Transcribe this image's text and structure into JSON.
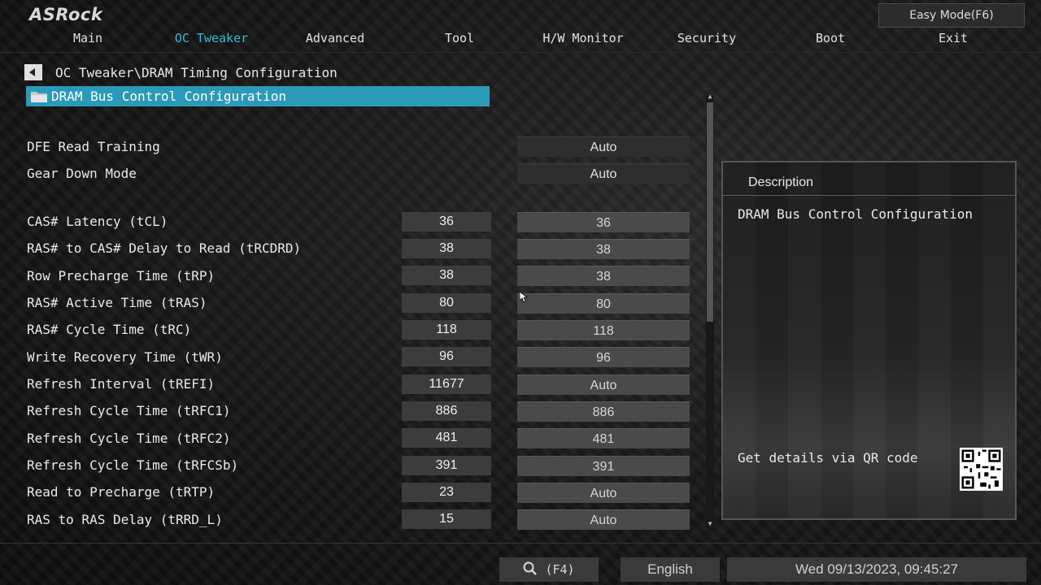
{
  "brand": "ASRock",
  "easy_mode_label": "Easy Mode(F6)",
  "tabs": [
    {
      "label": "Main",
      "active": false
    },
    {
      "label": "OC Tweaker",
      "active": true
    },
    {
      "label": "Advanced",
      "active": false
    },
    {
      "label": "Tool",
      "active": false
    },
    {
      "label": "H/W Monitor",
      "active": false
    },
    {
      "label": "Security",
      "active": false
    },
    {
      "label": "Boot",
      "active": false
    },
    {
      "label": "Exit",
      "active": false
    }
  ],
  "breadcrumb": "OC Tweaker\\DRAM Timing Configuration",
  "selected_item": "DRAM Bus Control Configuration",
  "options": [
    {
      "label": "DFE Read Training",
      "setting": "Auto"
    },
    {
      "label": "Gear Down Mode",
      "setting": "Auto"
    }
  ],
  "timings": [
    {
      "label": "CAS# Latency (tCL)",
      "current": "36",
      "setting": "36"
    },
    {
      "label": "RAS# to CAS# Delay to Read  (tRCDRD)",
      "current": "38",
      "setting": "38"
    },
    {
      "label": "Row Precharge Time (tRP)",
      "current": "38",
      "setting": "38"
    },
    {
      "label": "RAS# Active Time (tRAS)",
      "current": "80",
      "setting": "80"
    },
    {
      "label": "RAS# Cycle Time (tRC)",
      "current": "118",
      "setting": "118"
    },
    {
      "label": "Write Recovery Time (tWR)",
      "current": "96",
      "setting": "96"
    },
    {
      "label": "Refresh Interval (tREFI)",
      "current": "11677",
      "setting": "Auto"
    },
    {
      "label": "Refresh Cycle Time (tRFC1)",
      "current": "886",
      "setting": "886"
    },
    {
      "label": "Refresh Cycle Time (tRFC2)",
      "current": "481",
      "setting": "481"
    },
    {
      "label": "Refresh Cycle Time (tRFCSb)",
      "current": "391",
      "setting": "391"
    },
    {
      "label": "Read to Precharge (tRTP)",
      "current": "23",
      "setting": "Auto"
    },
    {
      "label": "RAS to RAS Delay (tRRD_L)",
      "current": "15",
      "setting": "Auto"
    }
  ],
  "description": {
    "title": "Description",
    "text": "DRAM Bus Control Configuration",
    "qr_label": "Get details via QR code"
  },
  "footer": {
    "search_label": "(F4)",
    "language": "English",
    "datetime": "Wed 09/13/2023, 09:45:27"
  },
  "colors": {
    "accent": "#38b8d8",
    "highlight": "#2b9ab8"
  }
}
